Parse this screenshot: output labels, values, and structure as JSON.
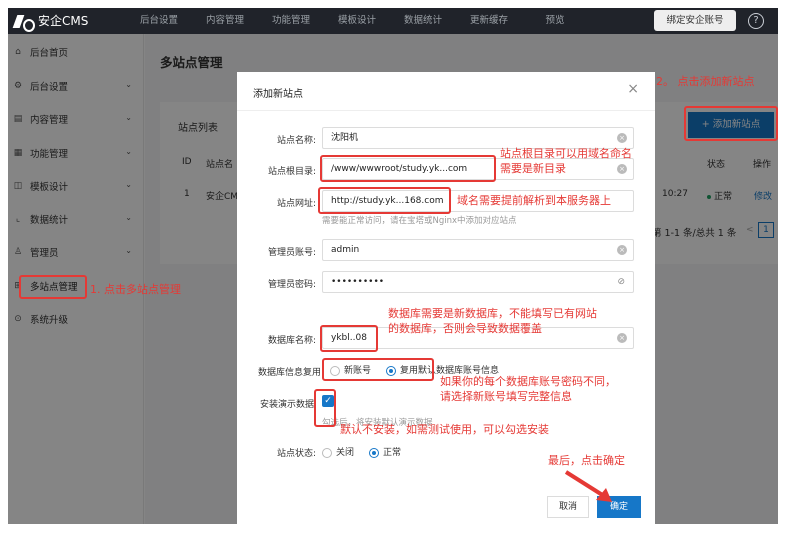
{
  "app": {
    "title": "安企CMS"
  },
  "topnav": [
    "后台设置",
    "内容管理",
    "功能管理",
    "模板设计",
    "数据统计",
    "更新缓存",
    "预览"
  ],
  "header": {
    "bind_label": "绑定安企账号",
    "help_glyph": "?"
  },
  "sidebar": {
    "items": [
      {
        "label": "后台首页",
        "icon": "home-icon",
        "glyph": "⌂"
      },
      {
        "label": "后台设置",
        "icon": "gear-icon",
        "glyph": "⚙"
      },
      {
        "label": "内容管理",
        "icon": "document-icon",
        "glyph": "▤"
      },
      {
        "label": "功能管理",
        "icon": "grid-icon",
        "glyph": "▦"
      },
      {
        "label": "模板设计",
        "icon": "template-icon",
        "glyph": "◫"
      },
      {
        "label": "数据统计",
        "icon": "chart-icon",
        "glyph": "⌞"
      },
      {
        "label": "管理员",
        "icon": "user-icon",
        "glyph": "♙"
      },
      {
        "label": "多站点管理",
        "icon": "sites-icon",
        "glyph": "⊞"
      },
      {
        "label": "系统升级",
        "icon": "upgrade-icon",
        "glyph": "⊙"
      }
    ],
    "chevron": "⌄"
  },
  "page": {
    "title": "多站点管理"
  },
  "list": {
    "title": "站点列表",
    "add_button": "+ 添加新站点",
    "columns": {
      "id": "ID",
      "name": "站点名",
      "status": "状态",
      "ops": "操作"
    },
    "row": {
      "id": "1",
      "name": "安企CM",
      "time": "10:27",
      "status": "正常",
      "op": "修改"
    },
    "pager_text": "第 1-1 条/总共 1 条",
    "pager_prev": "<",
    "pager_page": "1"
  },
  "modal": {
    "title": "添加新站点",
    "close_glyph": "×",
    "fields": {
      "site_name": {
        "label": "站点名称:",
        "value": "沈阳机"
      },
      "root_dir": {
        "label": "站点根目录:",
        "value": "/www/wwwroot/study.yk...com"
      },
      "site_url": {
        "label": "站点网址:",
        "value": "http://study.yk...168.com"
      },
      "url_hint": "需要能正常访问，请在宝塔或Nginx中添加对应站点",
      "admin_user": {
        "label": "管理员账号:",
        "value": "admin"
      },
      "admin_pass": {
        "label": "管理员密码:",
        "value": "••••••••••"
      },
      "db_name": {
        "label": "数据库名称:",
        "value": "ykbl..08"
      },
      "db_reuse": {
        "label": "数据库信息复用:",
        "opt_new": "新账号",
        "opt_reuse": "复用默认数据库账号信息"
      },
      "demo": {
        "label": "安装演示数据",
        "hint": "勾选后，将安装默认演示数据"
      },
      "status": {
        "label": "站点状态:",
        "opt_off": "关闭",
        "opt_on": "正常"
      }
    },
    "cancel": "取消",
    "ok": "确定"
  },
  "annotations": {
    "step1": "1. 点击多站点管理",
    "step2": "2。 点击添加新站点",
    "root_dir_note": "站点根目录可以用域名命名\n需要是新目录",
    "url_note": "域名需要提前解析到本服务器上",
    "db_note": "数据库需要是新数据库，不能填写已有网站\n的数据库，否则会导致数据覆盖",
    "account_note": "如果你的每个数据库账号密码不同，\n请选择新账号填写完整信息",
    "demo_note": "默认不安装，如需测试使用，可以勾选安装",
    "final_note": "最后，点击确定"
  },
  "colors": {
    "accent": "#1677c8",
    "annotation": "#e53935",
    "topbar": "#20232a"
  }
}
